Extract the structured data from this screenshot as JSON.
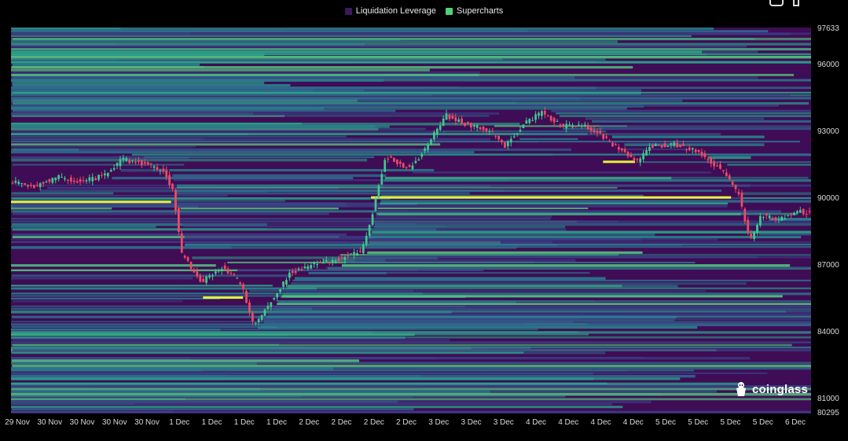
{
  "legend": {
    "items": [
      {
        "label": "Liquidation Leverage",
        "color": "#3a1a5c"
      },
      {
        "label": "Supercharts",
        "color": "#4fd17a"
      }
    ]
  },
  "watermark": {
    "text": "coinglass",
    "icon": "coinglass-logo-icon"
  },
  "colors": {
    "background": "#000000",
    "heatmap_base": "#3f0d55",
    "candle_up": "#3ec98f",
    "candle_down": "#f04a64",
    "high_liquidity": "#e8f23a",
    "axis_text": "#d9d9d9"
  },
  "chart_data": {
    "type": "heatmap",
    "title": "",
    "overlay": "candlestick",
    "y_axis": {
      "position": "right",
      "min": 80295,
      "max": 97633,
      "tick_labels": [
        "97633",
        "96000",
        "93000",
        "90000",
        "87000",
        "84000",
        "81000",
        "80295"
      ]
    },
    "x_axis": {
      "tick_labels": [
        "29 Nov",
        "30 Nov",
        "30 Nov",
        "30 Nov",
        "30 Nov",
        "1 Dec",
        "1 Dec",
        "1 Dec",
        "1 Dec",
        "2 Dec",
        "2 Dec",
        "2 Dec",
        "2 Dec",
        "3 Dec",
        "3 Dec",
        "3 Dec",
        "4 Dec",
        "4 Dec",
        "4 Dec",
        "4 Dec",
        "5 Dec",
        "5 Dec",
        "5 Dec",
        "5 Dec",
        "6 Dec"
      ]
    },
    "price_path": [
      [
        0,
        90700
      ],
      [
        0.03,
        90500
      ],
      [
        0.06,
        90900
      ],
      [
        0.09,
        90700
      ],
      [
        0.12,
        91000
      ],
      [
        0.14,
        91700
      ],
      [
        0.17,
        91500
      ],
      [
        0.195,
        91100
      ],
      [
        0.205,
        90200
      ],
      [
        0.215,
        87500
      ],
      [
        0.24,
        86200
      ],
      [
        0.265,
        86900
      ],
      [
        0.29,
        86100
      ],
      [
        0.305,
        84300
      ],
      [
        0.325,
        85200
      ],
      [
        0.35,
        86600
      ],
      [
        0.38,
        87000
      ],
      [
        0.41,
        87200
      ],
      [
        0.44,
        87600
      ],
      [
        0.455,
        89500
      ],
      [
        0.47,
        91800
      ],
      [
        0.5,
        91300
      ],
      [
        0.52,
        92200
      ],
      [
        0.545,
        93700
      ],
      [
        0.57,
        93300
      ],
      [
        0.6,
        93000
      ],
      [
        0.62,
        92300
      ],
      [
        0.645,
        93400
      ],
      [
        0.665,
        93800
      ],
      [
        0.69,
        93200
      ],
      [
        0.715,
        93300
      ],
      [
        0.735,
        92900
      ],
      [
        0.76,
        92200
      ],
      [
        0.785,
        91600
      ],
      [
        0.8,
        92300
      ],
      [
        0.83,
        92400
      ],
      [
        0.855,
        92100
      ],
      [
        0.87,
        91800
      ],
      [
        0.895,
        91100
      ],
      [
        0.912,
        90100
      ],
      [
        0.925,
        88100
      ],
      [
        0.94,
        89200
      ],
      [
        0.96,
        89000
      ],
      [
        0.985,
        89400
      ],
      [
        1.0,
        89300
      ]
    ],
    "high_liquidity_levels": [
      {
        "price": 89800,
        "from": 0.0,
        "to": 0.2
      },
      {
        "price": 85500,
        "from": 0.24,
        "to": 0.29
      },
      {
        "price": 90000,
        "from": 0.45,
        "to": 0.9
      },
      {
        "price": 91600,
        "from": 0.74,
        "to": 0.78
      }
    ],
    "grid": false,
    "legend_position": "top-center"
  }
}
